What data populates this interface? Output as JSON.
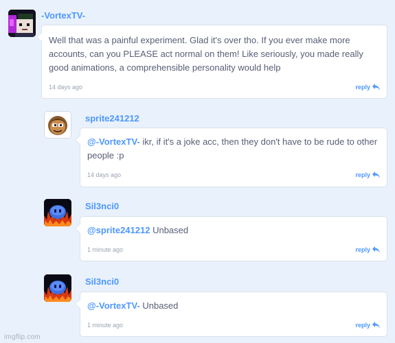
{
  "comments": [
    {
      "username": "-VortexTV-",
      "mention": "",
      "text": "Well that was a painful experiment. Glad it's over tho. If you ever make more accounts, can you PLEASE act normal on them! Like seriously, you made really good animations, a comprehensible personality would help",
      "time": "14 days ago",
      "reply_label": "reply",
      "avatar_icon": "glitch-character-avatar-icon"
    },
    {
      "username": "sprite241212",
      "mention": "@-VortexTV-",
      "text": " ikr, if it's a joke acc, then they don't have to be rude to other people :p",
      "time": "14 days ago",
      "reply_label": "reply",
      "avatar_icon": "cartoon-face-avatar-icon"
    },
    {
      "username": "Sil3nci0",
      "mention": "@sprite241212",
      "text": " Unbased",
      "time": "1 minute ago",
      "reply_label": "reply",
      "avatar_icon": "blue-blob-fire-avatar-icon"
    },
    {
      "username": "Sil3nci0",
      "mention": "@-VortexTV-",
      "text": " Unbased",
      "time": "1 minute ago",
      "reply_label": "reply",
      "avatar_icon": "blue-blob-fire-avatar-icon"
    }
  ],
  "watermark": "imgflip.com",
  "colors": {
    "link": "#4d97ff",
    "body_text": "#575e75",
    "page_bg": "#e9f1fc"
  }
}
